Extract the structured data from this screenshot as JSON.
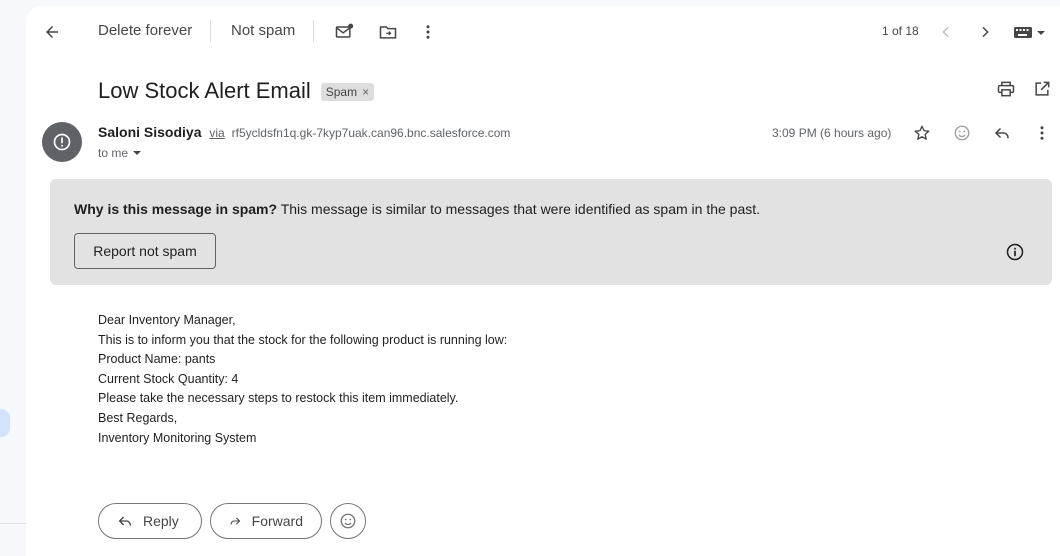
{
  "toolbar": {
    "back_icon": "arrow-left-icon",
    "delete_forever": "Delete forever",
    "not_spam": "Not spam",
    "mark_unread_icon": "mail-dot-icon",
    "move_to_icon": "folder-move-icon",
    "more_icon": "more-vert-icon",
    "counter": "1 of 18",
    "prev_icon": "chevron-left-icon",
    "next_icon": "chevron-right-icon",
    "keyboard_icon": "keyboard-icon"
  },
  "email": {
    "subject": "Low Stock Alert Email",
    "label": "Spam",
    "label_remove": "×",
    "sender_name": "Saloni Sisodiya",
    "via": "via",
    "via_address": "rf5ycldsfn1q.gk-7kyp7uak.can96.bnc.salesforce.com",
    "to": "to me",
    "timestamp": "3:09 PM (6 hours ago)"
  },
  "spam_notice": {
    "question": "Why is this message in spam?",
    "explanation": " This message is similar to messages that were identified as spam in the past.",
    "report_button": "Report not spam"
  },
  "body": {
    "lines": [
      "Dear Inventory Manager,",
      "This is to inform you that the stock for the following product is running low:",
      "Product Name: pants",
      "Current Stock Quantity: 4",
      "Please take the necessary steps to restock this item immediately.",
      "Best Regards,",
      "Inventory Monitoring System"
    ]
  },
  "actions": {
    "reply": "Reply",
    "forward": "Forward"
  },
  "colors": {
    "panel": "#ffffff",
    "background": "#f6f8fc",
    "spam_box": "#e2e2e2",
    "avatar": "#5f6368"
  }
}
